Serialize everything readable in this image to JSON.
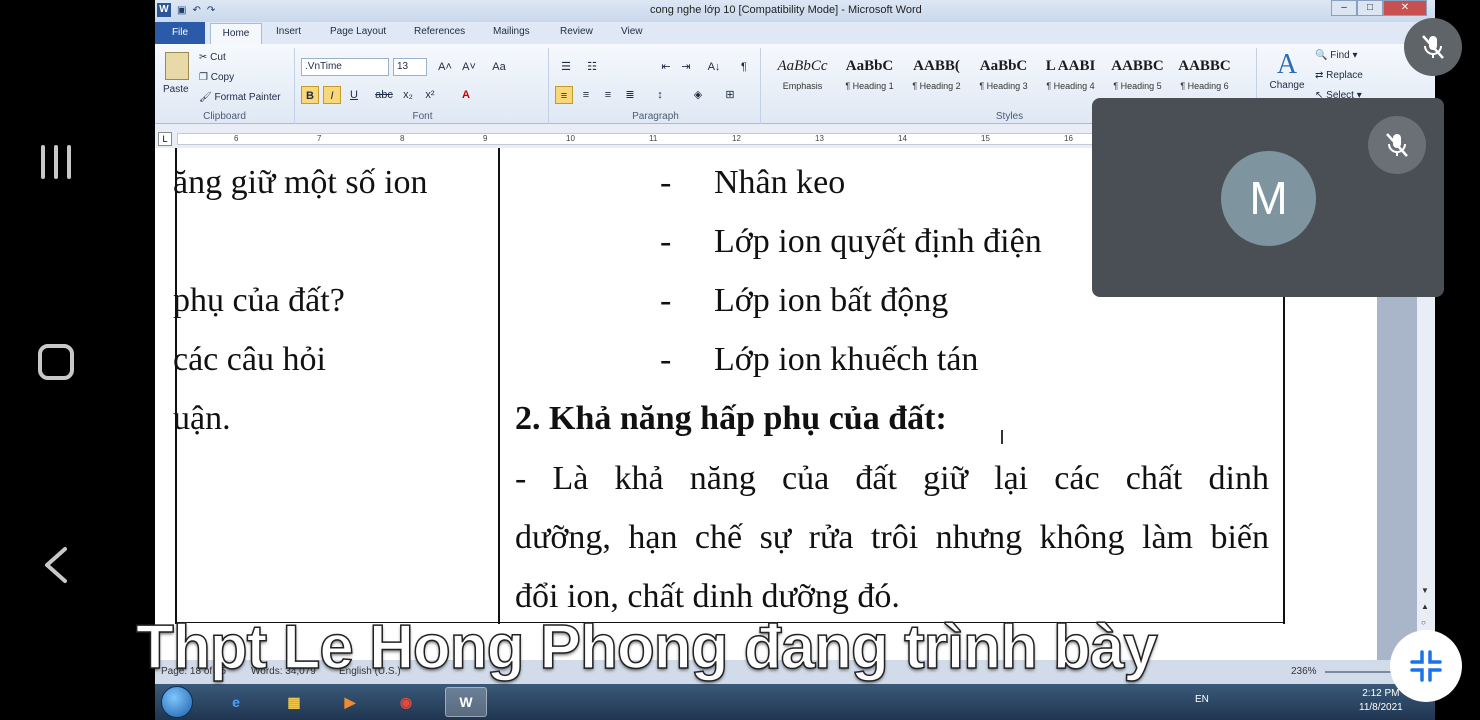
{
  "window": {
    "title": "cong nghe lớp 10 [Compatibility Mode] - Microsoft Word",
    "qat_w": "W",
    "min": "–",
    "max": "□",
    "close": "✕"
  },
  "tabs": [
    "File",
    "Home",
    "Insert",
    "Page Layout",
    "References",
    "Mailings",
    "Review",
    "View"
  ],
  "ribbon": {
    "clipboard": {
      "paste": "Paste",
      "cut": "Cut",
      "copy": "Copy",
      "format_painter": "Format Painter",
      "label": "Clipboard"
    },
    "font": {
      "name": ".VnTime",
      "size": "13",
      "label": "Font",
      "bold": "B",
      "italic": "I",
      "underline": "U",
      "strike": "abc",
      "sub": "x₂",
      "sup": "x²",
      "grow": "A˄",
      "shrink": "A˅",
      "case": "Aa"
    },
    "paragraph": {
      "label": "Paragraph",
      "pilcrow": "¶",
      "sort": "A↓"
    },
    "styles": {
      "label": "Styles",
      "items": [
        {
          "preview": "AaBbCc",
          "name": "Emphasis"
        },
        {
          "preview": "AaBbC",
          "name": "¶ Heading 1"
        },
        {
          "preview": "AABB(",
          "name": "¶ Heading 2"
        },
        {
          "preview": "AaBbC",
          "name": "¶ Heading 3"
        },
        {
          "preview": "L AABI",
          "name": "¶ Heading 4"
        },
        {
          "preview": "AABBC",
          "name": "¶ Heading 5"
        },
        {
          "preview": "AABBC",
          "name": "¶ Heading 6"
        }
      ],
      "change_glyph": "A",
      "change": "Change"
    },
    "editing": {
      "find": "Find ▾",
      "replace": "Replace",
      "select": "Select ▾"
    }
  },
  "ruler": {
    "marks": [
      "6",
      "7",
      "8",
      "9",
      "10",
      "11",
      "12",
      "13",
      "14",
      "15",
      "16"
    ],
    "tab_selector": "L"
  },
  "document": {
    "left_col": [
      "ăng giữ một số ion",
      "phụ của đất?",
      "các câu hỏi",
      "uận."
    ],
    "dash": "-",
    "list": [
      "Nhân keo",
      "Lớp ion quyết định điện",
      "Lớp ion bất động",
      "Lớp ion khuếch tán"
    ],
    "heading": "2. Khả năng hấp phụ của đất:",
    "paragraph_lines": [
      "- Là khả năng của đất giữ lại các chất dinh",
      "dưỡng, hạn chế sự rửa trôi nhưng không làm biến",
      "đổi ion, chất dinh dưỡng đó."
    ]
  },
  "status": {
    "page": "Page: 18 of 25",
    "words": "Words: 34,079",
    "language": "English (U.S.)",
    "zoom": "236%"
  },
  "taskbar": {
    "word_label": "W",
    "lang": "EN",
    "time": "2:12 PM",
    "date": "11/8/2021"
  },
  "meet": {
    "avatar_initial": "M",
    "presenting": "Thpt Le Hong Phong đang trình bày",
    "avatar_color": "#7e95a0",
    "tile_color": "#4a4f55"
  }
}
